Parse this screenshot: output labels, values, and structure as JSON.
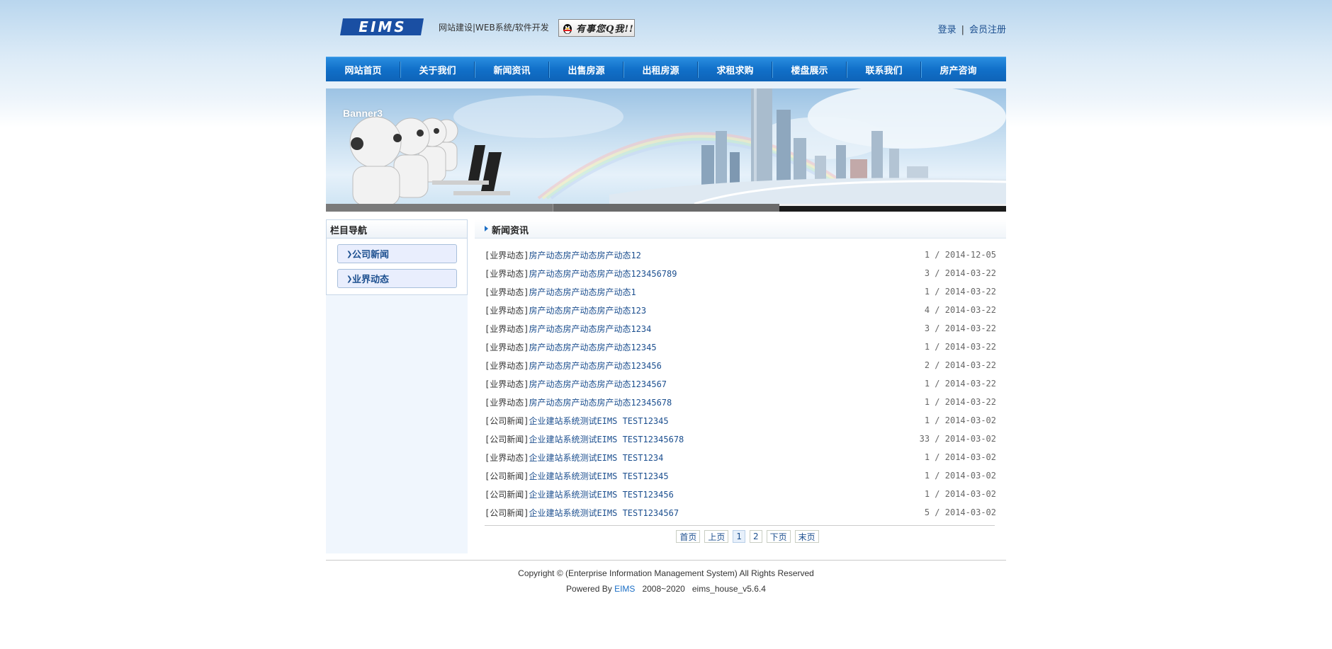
{
  "header": {
    "logo_text": "EIMS",
    "slogan": "网站建设|WEB系统/软件开发",
    "qq_button": "有事您Q我!!",
    "login": "登录",
    "separator": "|",
    "register": "会员注册"
  },
  "nav": [
    "网站首页",
    "关于我们",
    "新闻资讯",
    "出售房源",
    "出租房源",
    "求租求购",
    "楼盘展示",
    "联系我们",
    "房产咨询"
  ],
  "banner": {
    "label": "Banner3"
  },
  "sidebar": {
    "title": "栏目导航",
    "items": [
      "公司新闻",
      "业界动态"
    ]
  },
  "main": {
    "title": "新闻资讯",
    "rows": [
      {
        "cat": "[业界动态]",
        "title": "房产动态房产动态房产动态12",
        "meta": "1 / 2014-12-05"
      },
      {
        "cat": "[业界动态]",
        "title": "房产动态房产动态房产动态123456789",
        "meta": "3 / 2014-03-22"
      },
      {
        "cat": "[业界动态]",
        "title": "房产动态房产动态房产动态1",
        "meta": "1 / 2014-03-22"
      },
      {
        "cat": "[业界动态]",
        "title": "房产动态房产动态房产动态123",
        "meta": "4 / 2014-03-22"
      },
      {
        "cat": "[业界动态]",
        "title": "房产动态房产动态房产动态1234",
        "meta": "3 / 2014-03-22"
      },
      {
        "cat": "[业界动态]",
        "title": "房产动态房产动态房产动态12345",
        "meta": "1 / 2014-03-22"
      },
      {
        "cat": "[业界动态]",
        "title": "房产动态房产动态房产动态123456",
        "meta": "2 / 2014-03-22"
      },
      {
        "cat": "[业界动态]",
        "title": "房产动态房产动态房产动态1234567",
        "meta": "1 / 2014-03-22"
      },
      {
        "cat": "[业界动态]",
        "title": "房产动态房产动态房产动态12345678",
        "meta": "1 / 2014-03-22"
      },
      {
        "cat": "[公司新闻]",
        "title": "企业建站系统测试EIMS TEST12345",
        "meta": "1 / 2014-03-02"
      },
      {
        "cat": "[公司新闻]",
        "title": "企业建站系统测试EIMS TEST12345678",
        "meta": "33 / 2014-03-02"
      },
      {
        "cat": "[业界动态]",
        "title": "企业建站系统测试EIMS TEST1234",
        "meta": "1 / 2014-03-02"
      },
      {
        "cat": "[公司新闻]",
        "title": "企业建站系统测试EIMS TEST12345",
        "meta": "1 / 2014-03-02"
      },
      {
        "cat": "[公司新闻]",
        "title": "企业建站系统测试EIMS TEST123456",
        "meta": "1 / 2014-03-02"
      },
      {
        "cat": "[公司新闻]",
        "title": "企业建站系统测试EIMS TEST1234567",
        "meta": "5 / 2014-03-02"
      }
    ]
  },
  "pager": {
    "first": "首页",
    "prev": "上页",
    "pages": [
      "1",
      "2"
    ],
    "current": "1",
    "next": "下页",
    "last": "末页"
  },
  "footer": {
    "copyright": "Copyright © (Enterprise Information Management System) All Rights Reserved",
    "powered_prefix": "Powered By",
    "powered_brand": "EIMS",
    "years": "2008~2020",
    "version": "eims_house_v5.6.4"
  },
  "colors": {
    "nav_blue": "#1170c9",
    "link_blue": "#1c4f8f",
    "accent_blue": "#1c6fc6"
  }
}
